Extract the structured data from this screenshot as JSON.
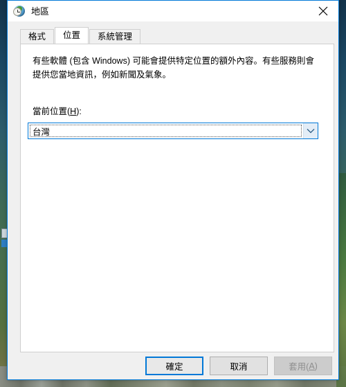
{
  "window": {
    "title": "地區",
    "icon": "region-globe-clock-icon",
    "close_label": "×",
    "accent_color": "#0078d7",
    "titlebar_bg": "#ffffff",
    "dialog_bg": "#f0f0f0"
  },
  "tabs": [
    {
      "label": "格式",
      "selected": false
    },
    {
      "label": "位置",
      "selected": true
    },
    {
      "label": "系統管理",
      "selected": false
    }
  ],
  "content": {
    "description": "有些軟體 (包含 Windows) 可能會提供特定位置的額外內容。有些服務則會提供您當地資訊，例如新聞及氣象。",
    "location_label_prefix": "當前位置(",
    "location_label_accesskey": "H",
    "location_label_suffix": "):",
    "location_value": "台灣",
    "dropdown_icon": "chevron-down-icon"
  },
  "buttons": {
    "ok": "確定",
    "cancel": "取消",
    "apply_prefix": "套用(",
    "apply_accesskey": "A",
    "apply_suffix": ")",
    "apply_enabled": false
  }
}
